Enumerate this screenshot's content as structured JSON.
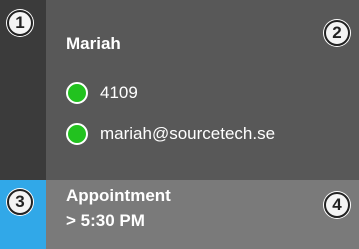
{
  "contact": {
    "name": "Mariah",
    "phone": "4109",
    "email": "mariah@sourcetech.se",
    "presence_color": "#22c21f"
  },
  "appointment": {
    "title": "Appointment",
    "time": "> 5:30 PM"
  },
  "markers": [
    "1",
    "2",
    "3",
    "4"
  ],
  "colors": {
    "contact_background": "#585858",
    "sidebar_background": "#3b3b3b",
    "appointment_background": "#7a7a7a",
    "accent": "#31a8e8"
  }
}
